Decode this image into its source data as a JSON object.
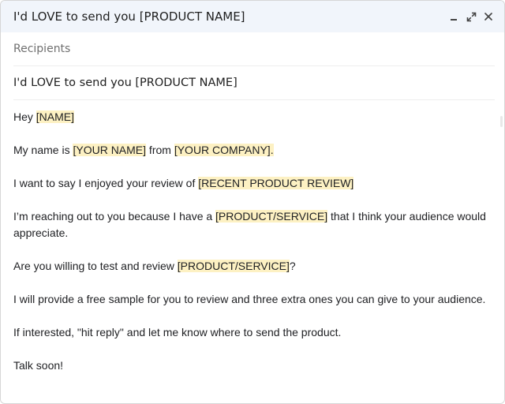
{
  "window": {
    "title": "I'd LOVE to send you [PRODUCT NAME]",
    "icons": [
      "minimize-icon",
      "pop-out-icon",
      "close-icon"
    ]
  },
  "compose": {
    "recipients_placeholder": "Recipients",
    "subject": "I'd LOVE to send you [PRODUCT NAME]"
  },
  "body": {
    "greeting": {
      "t0": "Hey ",
      "h0": "[NAME]"
    },
    "intro": {
      "t0": "My name is ",
      "h0": "[YOUR NAME]",
      "t1": " from ",
      "h1": "[YOUR COMPANY]."
    },
    "review": {
      "t0": "I want to say I enjoyed your review of ",
      "h0": "[RECENT PRODUCT REVIEW]"
    },
    "reason": {
      "t0": "I’m reaching out to you because I have a ",
      "h0": "[PRODUCT/SERVICE]",
      "t1": " that I think your audience would appreciate."
    },
    "ask": {
      "t0": "Are you willing to test and review ",
      "h0": "[PRODUCT/SERVICE]",
      "t1": "?"
    },
    "offer": "I will provide a free sample for you to review and three extra ones you can give to your audience.",
    "cta": "If interested, \"hit reply\" and let me know where to send the product.",
    "signoff": "Talk soon!"
  },
  "colors": {
    "titlebar_bg": "#f1f5fb",
    "highlight": "#fdf1c3",
    "text": "#202124",
    "muted": "#6f6f6f"
  }
}
